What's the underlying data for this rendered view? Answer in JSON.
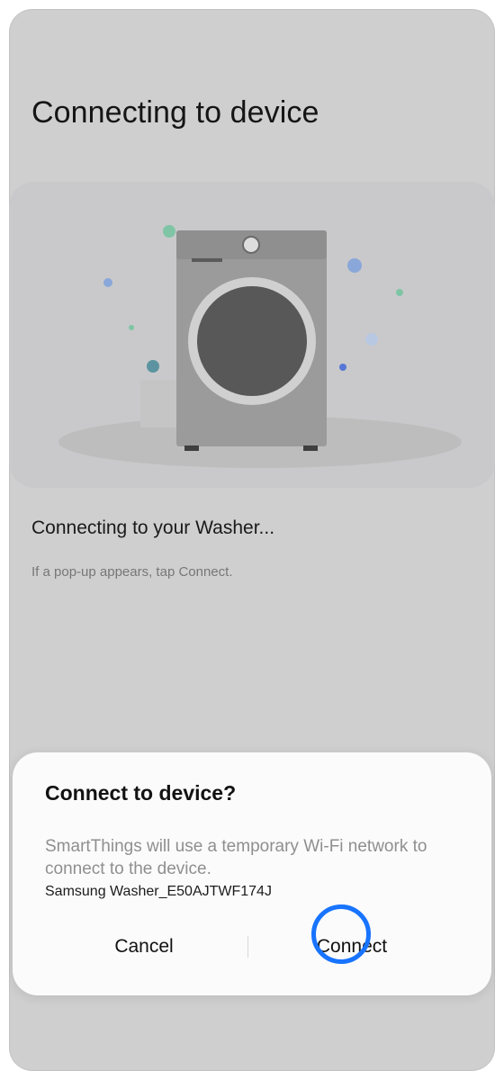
{
  "page": {
    "title": "Connecting to device"
  },
  "illustration": {
    "device_type": "washer-illustration",
    "colors": {
      "card_bg": "#c9c9cb",
      "shadow_ellipse": "#bdbdbd",
      "washer_body": "#9b9b9b",
      "washer_top": "#8f8f8f",
      "washer_door_outer": "#d0d0d0",
      "washer_door_inner": "#585858",
      "dot_green": "#7fc5a5",
      "dot_blue": "#8aa7d9",
      "dot_teal": "#5b94a0",
      "dot_indigo": "#5677d6"
    }
  },
  "status": {
    "message": "Connecting to your Washer...",
    "hint": "If a pop-up appears, tap Connect."
  },
  "dialog": {
    "title": "Connect to device?",
    "message": "SmartThings will use a temporary Wi-Fi network to connect to the device.",
    "network_name": "Samsung Washer_E50AJTWF174J",
    "cancel_label": "Cancel",
    "connect_label": "Connect"
  },
  "colors": {
    "screen_bg": "#cfcfcf",
    "dialog_bg": "#fbfbfb",
    "tap_indicator": "#1874ff"
  }
}
